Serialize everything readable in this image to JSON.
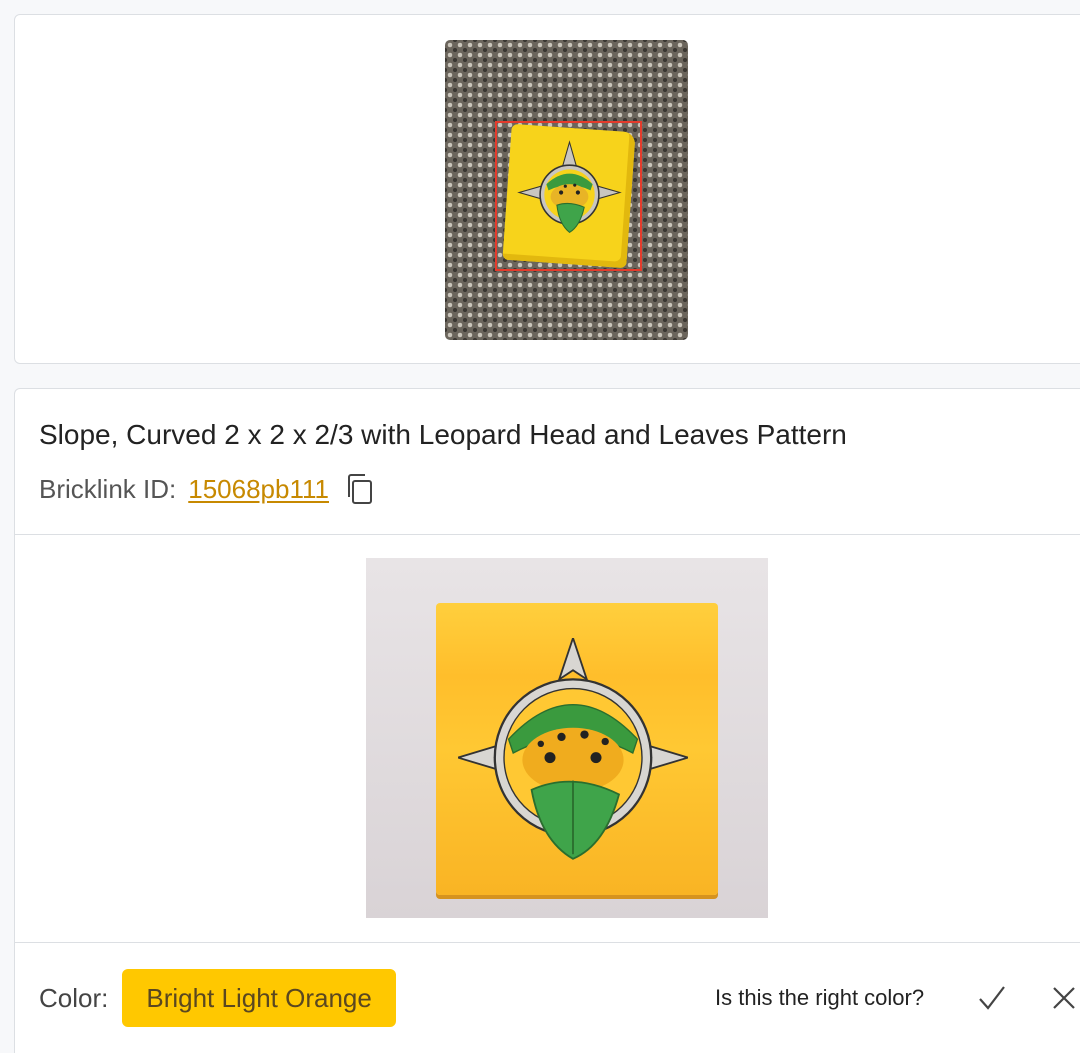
{
  "photo_card": {
    "photo_icon": "uploaded-photo",
    "detection_color": "#e53b2c"
  },
  "part": {
    "name": "Slope, Curved 2 x 2 x 2/3 with Leopard Head and Leaves Pattern",
    "bricklink_label": "Bricklink ID:",
    "bricklink_id": "15068pb111",
    "copy_icon": "copy-icon",
    "reference_image": "reference-part-image"
  },
  "color": {
    "label": "Color:",
    "value": "Bright Light Orange",
    "swatch": "#ffc800",
    "question": "Is this the right color?",
    "confirm_icon": "check-icon",
    "reject_icon": "x-icon"
  },
  "colors": {
    "accent_link": "#c78900",
    "border": "#dcdfe3"
  }
}
